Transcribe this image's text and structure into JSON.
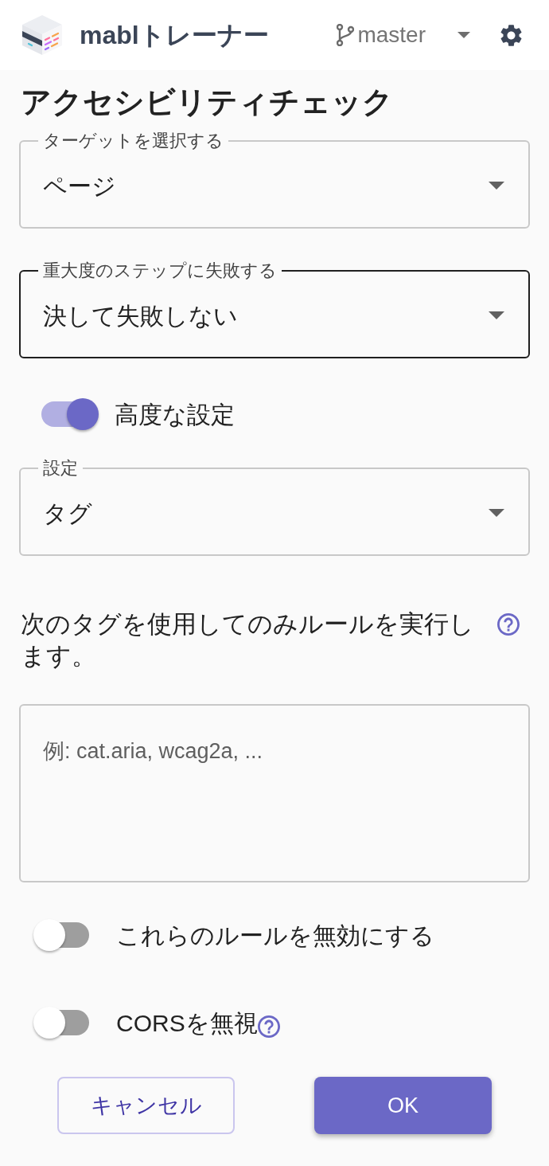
{
  "header": {
    "title": "mablトレーナー",
    "branch": "master"
  },
  "page_title": "アクセシビリティチェック",
  "fields": [
    {
      "kind": "select",
      "label": "ターゲットを選択する",
      "value": "ページ",
      "focused": false
    },
    {
      "kind": "select",
      "label": "重大度のステップに失敗する",
      "value": "決して失敗しない",
      "focused": true
    },
    {
      "kind": "toggle",
      "label": "高度な設定",
      "on": true,
      "help": false
    },
    {
      "kind": "select",
      "label": "設定",
      "value": "タグ",
      "focused": false
    },
    {
      "kind": "textarea",
      "description": "次のタグを使用してのみルールを実行します。",
      "help": true,
      "placeholder": "例: cat.aria, wcag2a, ..."
    },
    {
      "kind": "toggle",
      "label": "これらのルールを無効にする",
      "on": false,
      "help": false
    },
    {
      "kind": "toggle",
      "label": "CORSを無視",
      "on": false,
      "help": true
    }
  ],
  "buttons": [
    {
      "kind": "secondary",
      "label": "キャンセル"
    },
    {
      "kind": "primary",
      "label": "OK"
    }
  ]
}
